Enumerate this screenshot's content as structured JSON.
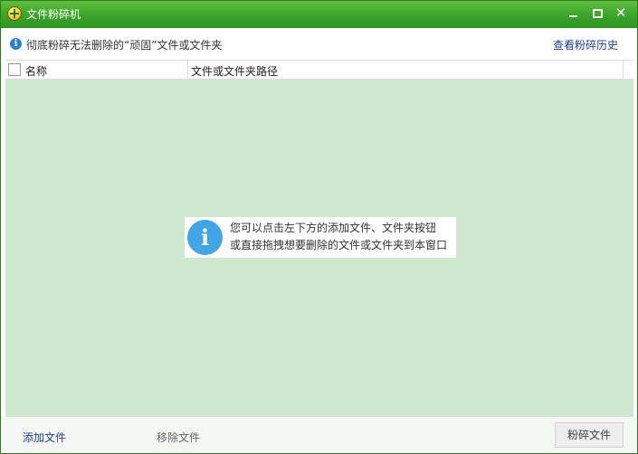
{
  "window": {
    "title": "文件粉碎机"
  },
  "infobar": {
    "text": "彻底粉碎无法删除的“顽固”文件或文件夹",
    "history_link": "查看粉碎历史"
  },
  "list": {
    "columns": [
      "名称",
      "文件或文件夹路径"
    ],
    "tip_line1": "您可以点击左下方的添加文件、文件夹按钮",
    "tip_line2": "或直接拖拽想要删除的文件或文件夹到本窗口"
  },
  "footer": {
    "add_label": "添加文件",
    "remove_label": "移除文件",
    "shred_label": "粉碎文件"
  },
  "colors": {
    "titlebar": "#3aa32a",
    "list_bg": "#cde8cf",
    "info_icon": "#42a6e6",
    "link": "#1f3f8a"
  },
  "icons": [
    "app-shredder-icon",
    "minimize-icon",
    "maximize-icon",
    "close-icon",
    "info-icon"
  ]
}
